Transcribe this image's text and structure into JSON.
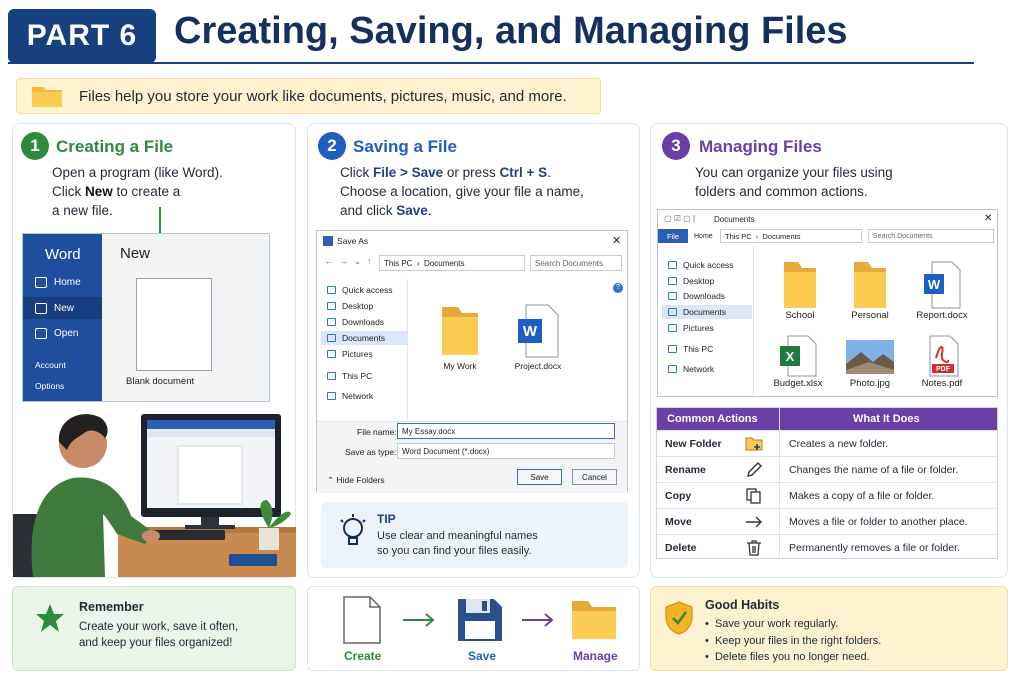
{
  "header": {
    "part": "PART 6",
    "title": "Creating, Saving, and Managing Files"
  },
  "intro": {
    "text": "Files help you store your work like documents, pictures, music, and more."
  },
  "colors": {
    "navy": "#16407e",
    "green": "#2e8b3e",
    "blue": "#1f5fc4",
    "purple": "#6b3fa8"
  },
  "step1": {
    "num": "1",
    "title": "Creating a File",
    "line1": "Open a program (like Word).",
    "line2_pre": "Click ",
    "line2_bold": "New",
    "line2_post": " to create a",
    "line3": "a new file.",
    "word": {
      "app": "Word",
      "new_heading": "New",
      "items": [
        "Home",
        "New",
        "Open"
      ],
      "bottom": [
        "Account",
        "Options"
      ],
      "blank": "Blank document"
    }
  },
  "step2": {
    "num": "2",
    "title": "Saving a File",
    "l1_pre": "Click ",
    "l1_b1": "File > Save",
    "l1_mid": " or press ",
    "l1_b2": "Ctrl + S",
    "l1_post": ".",
    "l2": "Choose a location, give your file a name,",
    "l3_pre": "and click ",
    "l3_b": "Save",
    "l3_post": ".",
    "dialog": {
      "title": "Save As",
      "path1": "This PC",
      "path2": "Documents",
      "search": "Search Documents",
      "nav": [
        "Quick access",
        "Desktop",
        "Downloads",
        "Documents",
        "Pictures",
        "This PC",
        "Network"
      ],
      "files": [
        "My Work",
        "Project.docx"
      ],
      "filename_label": "File name:",
      "filename": "My Essay.docx",
      "type_label": "Save as type:",
      "type": "Word Document (*.docx)",
      "hide": "Hide Folders",
      "save": "Save",
      "cancel": "Cancel"
    },
    "tip": {
      "label": "TIP",
      "l1": "Use clear and meaningful names",
      "l2": "so you can find your files easily."
    }
  },
  "step3": {
    "num": "3",
    "title": "Managing Files",
    "l1": "You can organize your files using",
    "l2": "folders and common actions.",
    "explorer": {
      "title": "Documents",
      "tab_file": "File",
      "tab_home": "Home",
      "path1": "This PC",
      "path2": "Documents",
      "search": "Search Documents",
      "nav": [
        "Quick access",
        "Desktop",
        "Downloads",
        "Documents",
        "Pictures",
        "This PC",
        "Network"
      ],
      "items": [
        "School",
        "Personal",
        "Report.docx",
        "Budget.xlsx",
        "Photo.jpg",
        "Notes.pdf"
      ]
    },
    "table": {
      "h1": "Common Actions",
      "h2": "What It Does",
      "rows": [
        {
          "action": "New Folder",
          "icon": "new-folder-icon",
          "desc": "Creates a new folder."
        },
        {
          "action": "Rename",
          "icon": "pencil-icon",
          "desc": "Changes the name of a file or folder."
        },
        {
          "action": "Copy",
          "icon": "copy-icon",
          "desc": "Makes a copy of a file or folder."
        },
        {
          "action": "Move",
          "icon": "arrow-right-icon",
          "desc": "Moves a file or folder to another place."
        },
        {
          "action": "Delete",
          "icon": "trash-icon",
          "desc": "Permanently removes a file or folder."
        }
      ]
    }
  },
  "remember": {
    "title": "Remember",
    "l1": "Create your work, save it often,",
    "l2": "and keep your files organized!"
  },
  "flow": {
    "create": "Create",
    "save": "Save",
    "manage": "Manage"
  },
  "habits": {
    "title": "Good Habits",
    "items": [
      "Save your work regularly.",
      "Keep your files in the right folders.",
      "Delete files you no longer need."
    ]
  }
}
